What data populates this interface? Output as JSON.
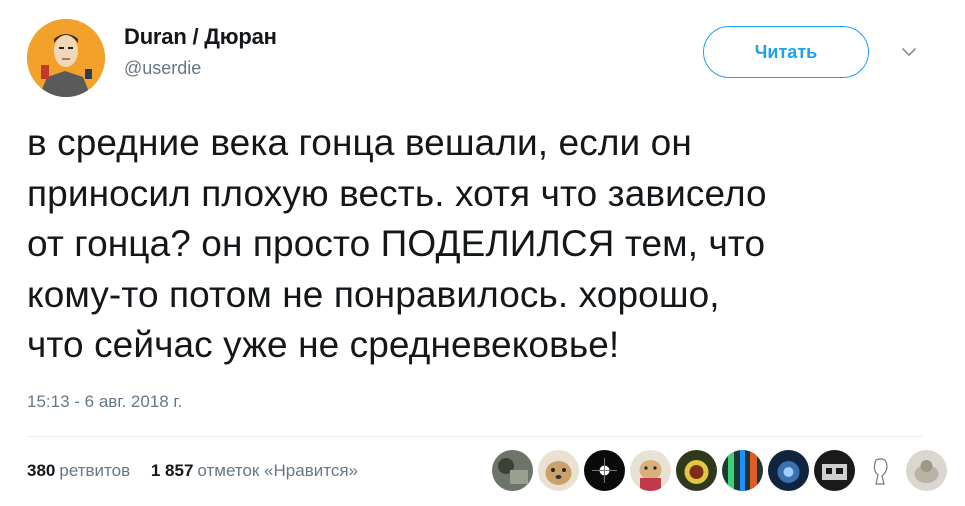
{
  "author": {
    "display_name": "Duran / Дюран",
    "handle": "@userdie"
  },
  "follow_button": {
    "label": "Читать"
  },
  "tweet": {
    "text": "в средние века гонца вешали, если он\nприносил плохую весть. хотя что зависело\nот гонца? он просто ПОДЕЛИЛСЯ тем, что\nкому-то потом не понравилось. хорошо,\nчто сейчас уже не средневековье!",
    "timestamp": "15:13 - 6 авг. 2018 г."
  },
  "stats": {
    "retweets_count": "380",
    "retweets_label": "ретвитов",
    "likes_count": "1 857",
    "likes_label": "отметок «Нравится»"
  },
  "colors": {
    "accent": "#1da1f2",
    "secondary_text": "#657786",
    "divider": "#e6ecf0"
  },
  "icons": {
    "menu": "chevron-down-icon"
  }
}
